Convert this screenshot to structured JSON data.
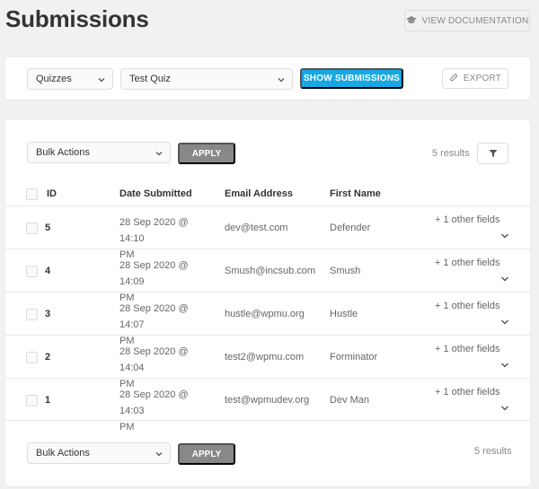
{
  "header": {
    "title": "Submissions",
    "doc_button": "VIEW DOCUMENTATION"
  },
  "toolbar": {
    "type_select": "Quizzes",
    "form_select": "Test Quiz",
    "show_button": "SHOW SUBMISSIONS",
    "export_button": "EXPORT"
  },
  "table_controls": {
    "bulk_top": "Bulk Actions",
    "apply_top": "APPLY",
    "results_top": "5 results",
    "bulk_bottom": "Bulk Actions",
    "apply_bottom": "APPLY",
    "results_bottom": "5 results"
  },
  "table": {
    "columns": [
      "ID",
      "Date Submitted",
      "Email Address",
      "First Name"
    ],
    "rows": [
      {
        "id": "5",
        "date_line1": "28 Sep 2020 @ 14:10",
        "date_line2": "PM",
        "email": "dev@test.com",
        "name": "Defender",
        "other": "+ 1 other fields"
      },
      {
        "id": "4",
        "date_line1": "28 Sep 2020 @ 14:09",
        "date_line2": "PM",
        "email": "Smush@incsub.com",
        "name": "Smush",
        "other": "+ 1 other fields"
      },
      {
        "id": "3",
        "date_line1": "28 Sep 2020 @ 14:07",
        "date_line2": "PM",
        "email": "hustle@wpmu.org",
        "name": "Hustle",
        "other": "+ 1 other fields"
      },
      {
        "id": "2",
        "date_line1": "28 Sep 2020 @ 14:04",
        "date_line2": "PM",
        "email": "test2@wpmu.com",
        "name": "Forminator",
        "other": "+ 1 other fields"
      },
      {
        "id": "1",
        "date_line1": "28 Sep 2020 @ 14:03",
        "date_line2": "PM",
        "email": "test@wpmudev.org",
        "name": "Dev Man",
        "other": "+ 1 other fields"
      }
    ]
  },
  "colors": {
    "accent": "#17a8e3",
    "apply_gray": "#888888",
    "background": "#f1f1f1"
  }
}
